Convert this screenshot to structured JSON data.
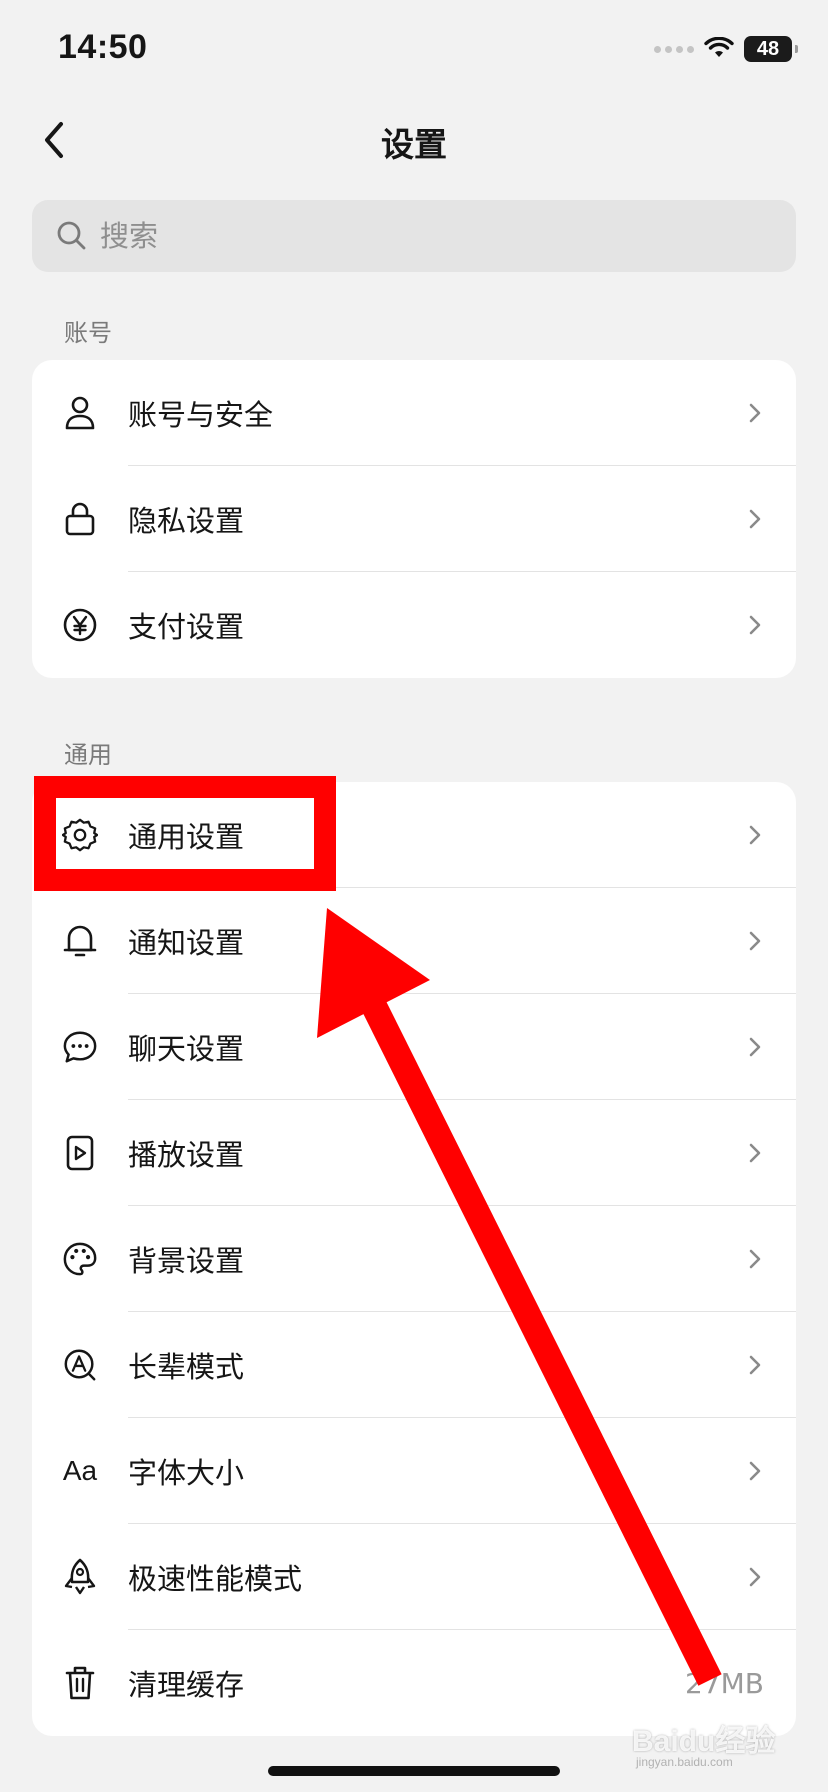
{
  "status_bar": {
    "time": "14:50",
    "battery": "48"
  },
  "nav": {
    "title": "设置"
  },
  "search": {
    "placeholder": "搜索"
  },
  "sections": {
    "account": {
      "label": "账号",
      "items": [
        {
          "label": "账号与安全",
          "icon": "user-icon"
        },
        {
          "label": "隐私设置",
          "icon": "lock-icon"
        },
        {
          "label": "支付设置",
          "icon": "yuan-icon"
        }
      ]
    },
    "general": {
      "label": "通用",
      "items": [
        {
          "label": "通用设置",
          "icon": "gear-icon"
        },
        {
          "label": "通知设置",
          "icon": "bell-icon"
        },
        {
          "label": "聊天设置",
          "icon": "chat-bubble-icon"
        },
        {
          "label": "播放设置",
          "icon": "play-icon"
        },
        {
          "label": "背景设置",
          "icon": "palette-icon"
        },
        {
          "label": "长辈模式",
          "icon": "elder-mode-icon"
        },
        {
          "label": "字体大小",
          "icon": "font-size-icon",
          "icon_text": "Aa"
        },
        {
          "label": "极速性能模式",
          "icon": "rocket-icon"
        },
        {
          "label": "清理缓存",
          "icon": "trash-icon",
          "value": "27MB"
        }
      ]
    }
  },
  "watermark": {
    "text": "Baidu经验",
    "subtext": "jingyan.baidu.com"
  },
  "annotation": {
    "color": "#ff0000"
  },
  "colors": {
    "background": "#f2f2f2",
    "card": "#ffffff",
    "accent_annotation": "#ff0000"
  }
}
